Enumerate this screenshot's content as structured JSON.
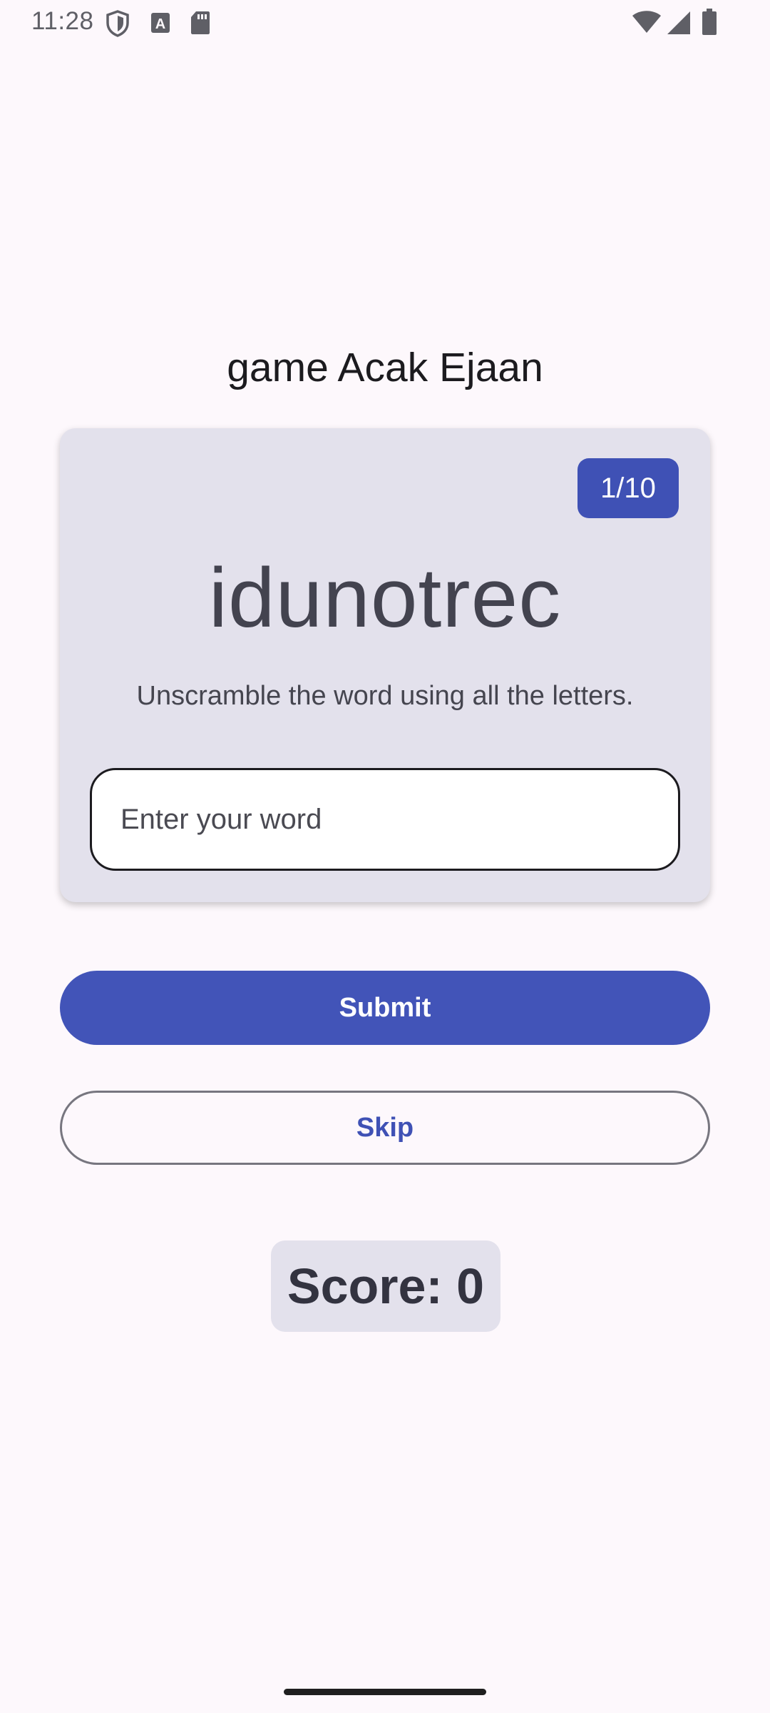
{
  "status_bar": {
    "time": "11:28",
    "icons": [
      "shield-icon",
      "a-icon",
      "sd-card-icon",
      "wifi-icon",
      "signal-icon",
      "battery-icon"
    ]
  },
  "app": {
    "title": "game Acak Ejaan"
  },
  "card": {
    "counter": "1/10",
    "scrambled_word": "idunotrec",
    "instructions": "Unscramble the word using all the letters.",
    "input": {
      "placeholder": "Enter your word",
      "value": ""
    }
  },
  "buttons": {
    "submit_label": "Submit",
    "skip_label": "Skip"
  },
  "score": {
    "text": "Score: 0"
  },
  "colors": {
    "primary": "#3f51b5",
    "card_background": "#e3e1ec",
    "page_background": "#fdf8fc"
  }
}
